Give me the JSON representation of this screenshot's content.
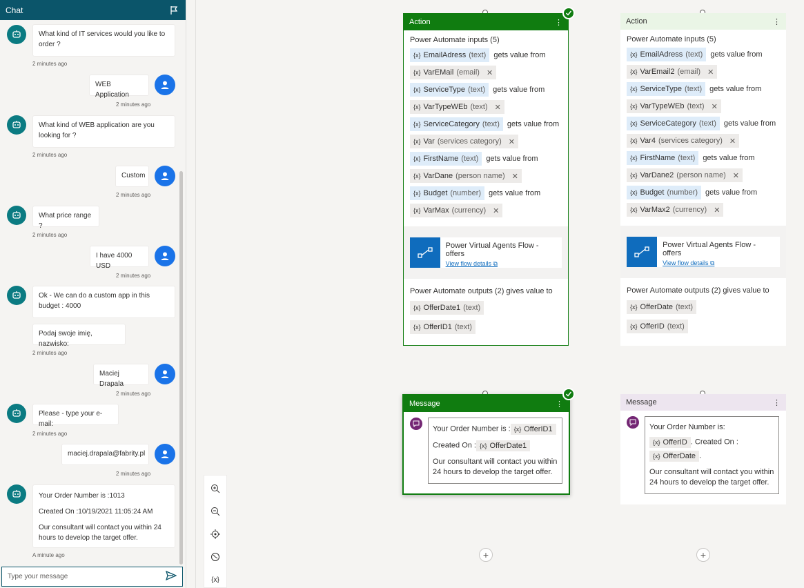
{
  "chat": {
    "title": "Chat",
    "input_placeholder": "Type your message",
    "messages": [
      {
        "from": "bot",
        "text": "What kind of IT services would you like to order ?",
        "time": "2 minutes ago"
      },
      {
        "from": "user",
        "text": "WEB Application",
        "time": "2 minutes ago"
      },
      {
        "from": "bot",
        "text": "What kind of WEB application are you looking for ?",
        "time": "2 minutes ago"
      },
      {
        "from": "user",
        "text": "Custom",
        "time": "2 minutes ago"
      },
      {
        "from": "bot",
        "text": "What price range ?",
        "time": "2 minutes ago"
      },
      {
        "from": "user",
        "text": "I have 4000 USD",
        "time": "2 minutes ago"
      },
      {
        "from": "bot",
        "text": "Ok - We can do a custom app in this budget : 4000",
        "text2": "Podaj swoje imię, nazwisko:",
        "time": "2 minutes ago"
      },
      {
        "from": "user",
        "text": "Maciej Drapala",
        "time": "2 minutes ago"
      },
      {
        "from": "bot",
        "text": "Please - type your e-mail:",
        "time": "2 minutes ago"
      },
      {
        "from": "user",
        "text": "maciej.drapala@fabrity.pl",
        "time": "2 minutes ago"
      },
      {
        "from": "bot",
        "line1": "Your Order Number is :1013",
        "line2": "Created On :10/19/2021 11:05:24 AM",
        "line3": "Our consultant will contact you within 24 hours to develop the target offer.",
        "time": "A minute ago"
      }
    ]
  },
  "nodes": {
    "action_left": {
      "title": "Action",
      "inputs_title": "Power Automate inputs (5)",
      "gets": "gets value from",
      "inputs": [
        {
          "name": "EmailAdress",
          "type": "(text)",
          "var": "VarEMail",
          "vtype": "(email)"
        },
        {
          "name": "ServiceType",
          "type": "(text)",
          "var": "VarTypeWEb",
          "vtype": "(text)"
        },
        {
          "name": "ServiceCategory",
          "type": "(text)",
          "var": "Var",
          "vtype": "(services category)"
        },
        {
          "name": "FirstName",
          "type": "(text)",
          "var": "VarDane",
          "vtype": "(person name)"
        },
        {
          "name": "Budget",
          "type": "(number)",
          "var": "VarMax",
          "vtype": "(currency)"
        }
      ],
      "flow_name": "Power Virtual Agents Flow - offers",
      "flow_link": "View flow details",
      "outputs_title": "Power Automate outputs (2) gives value to",
      "outputs": [
        {
          "name": "OfferDate1",
          "type": "(text)"
        },
        {
          "name": "OfferID1",
          "type": "(text)"
        }
      ]
    },
    "action_right": {
      "title": "Action",
      "inputs_title": "Power Automate inputs (5)",
      "gets": "gets value from",
      "inputs": [
        {
          "name": "EmailAdress",
          "type": "(text)",
          "var": "VarEmail2",
          "vtype": "(email)"
        },
        {
          "name": "ServiceType",
          "type": "(text)",
          "var": "VarTypeWEb",
          "vtype": "(text)"
        },
        {
          "name": "ServiceCategory",
          "type": "(text)",
          "var": "Var4",
          "vtype": "(services category)"
        },
        {
          "name": "FirstName",
          "type": "(text)",
          "var": "VarDane2",
          "vtype": "(person name)"
        },
        {
          "name": "Budget",
          "type": "(number)",
          "var": "VarMax2",
          "vtype": "(currency)"
        }
      ],
      "flow_name": "Power Virtual Agents Flow - offers",
      "flow_link": "View flow details",
      "outputs_title": "Power Automate outputs (2) gives value to",
      "outputs": [
        {
          "name": "OfferDate",
          "type": "(text)"
        },
        {
          "name": "OfferID",
          "type": "(text)"
        }
      ]
    },
    "message_left": {
      "title": "Message",
      "prefix1": "Your Order Number is :",
      "var1": "OfferID1",
      "prefix2": "Created On :",
      "var2": "OfferDate1",
      "body": "Our consultant will contact you within 24 hours to develop the target offer."
    },
    "message_right": {
      "title": "Message",
      "line1": "Your Order Number is:",
      "var1": "OfferID",
      "mid": ". Created On :",
      "var2": "OfferDate",
      "end": ".",
      "body": "Our consultant will contact you within 24 hours to develop the target offer."
    }
  },
  "var_badge": "{x}",
  "colors": {
    "header": "#0b556a",
    "active": "#107c10",
    "bot": "#0b7b82",
    "user": "#1a73e8",
    "flow": "#0f6cbd"
  }
}
